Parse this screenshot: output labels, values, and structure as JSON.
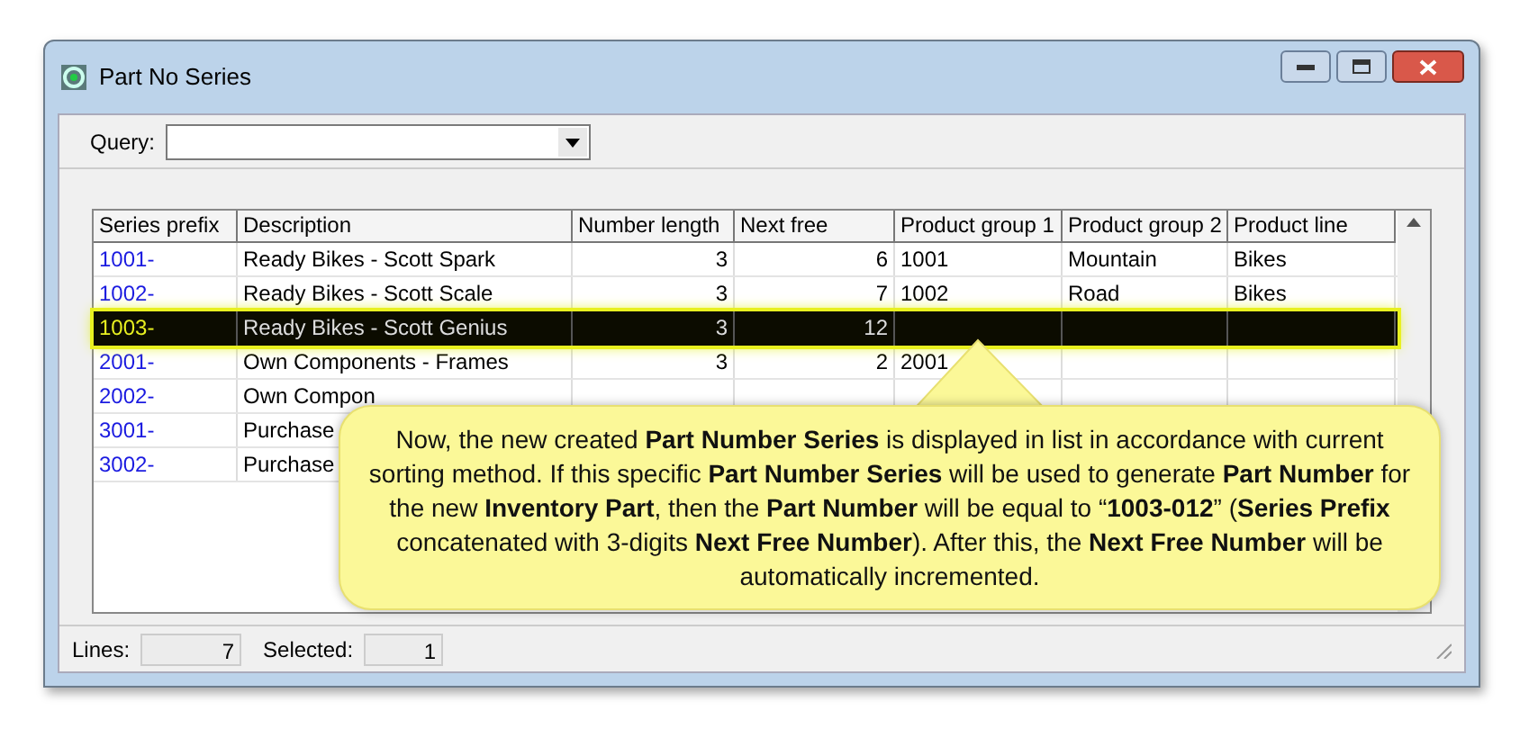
{
  "window": {
    "title": "Part No Series"
  },
  "query": {
    "label": "Query:"
  },
  "table": {
    "columns": [
      "Series prefix",
      "Description",
      "Number length",
      "Next free",
      "Product group 1",
      "Product group 2",
      "Product line"
    ],
    "rows": [
      {
        "cells": [
          "1001-",
          "Ready Bikes - Scott Spark",
          "3",
          "6",
          "1001",
          "Mountain",
          "Bikes"
        ],
        "selected": false
      },
      {
        "cells": [
          "1002-",
          "Ready Bikes - Scott Scale",
          "3",
          "7",
          "1002",
          "Road",
          "Bikes"
        ],
        "selected": false
      },
      {
        "cells": [
          "1003-",
          "Ready Bikes - Scott Genius",
          "3",
          "12",
          "",
          "",
          ""
        ],
        "selected": true
      },
      {
        "cells": [
          "2001-",
          "Own Components - Frames",
          "3",
          "2",
          "2001",
          "",
          ""
        ],
        "selected": false
      },
      {
        "cells": [
          "2002-",
          "Own Compon",
          "",
          "",
          "",
          "",
          ""
        ],
        "selected": false
      },
      {
        "cells": [
          "3001-",
          "Purchase",
          "",
          "",
          "",
          "",
          ""
        ],
        "selected": false
      },
      {
        "cells": [
          "3002-",
          "Purchase",
          "",
          "",
          "",
          "",
          ""
        ],
        "selected": false
      }
    ]
  },
  "callout": {
    "text": "Now, the new created **Part Number Series** is displayed in list in accordance with current sorting method.  If this specific **Part Number Series** will be used to generate **Part Number** for the new **Inventory Part**, then the **Part Number** will be equal to “**1003-012**” (**Series Prefix** concatenated with 3-digits **Next Free Number**). After this, the **Next Free Number** will be automatically incremented."
  },
  "status_bar": {
    "lines_label": "Lines:",
    "lines": "7",
    "selected_label": "Selected:",
    "selected": "1"
  }
}
